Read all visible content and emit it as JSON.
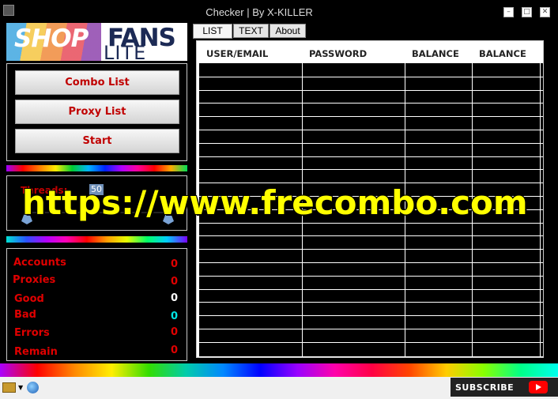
{
  "window": {
    "title": "Checker  | By X-KILLER"
  },
  "logo": {
    "line1": "SHOP",
    "line2": "FANS",
    "line3": "LITE"
  },
  "buttons": {
    "combo": "Combo List",
    "proxy": "Proxy List",
    "start": "Start"
  },
  "threads": {
    "label": "Threads:",
    "value": "50"
  },
  "stats": [
    {
      "label": "Accounts",
      "value": "0",
      "color": "#e00000"
    },
    {
      "label": "Proxies",
      "value": "0",
      "color": "#e00000"
    },
    {
      "label": "Good",
      "value": "0",
      "color": "#ffffff"
    },
    {
      "label": "Bad",
      "value": "0",
      "color": "#00e5e5"
    },
    {
      "label": "Errors",
      "value": "0",
      "color": "#e00000"
    },
    {
      "label": "Remain",
      "value": "0",
      "color": "#e00000"
    }
  ],
  "tabs": [
    "LIST",
    "TEXT",
    "About"
  ],
  "columns": [
    "USER/EMAIL",
    "PASSWORD",
    "BALANCE",
    "BALANCE"
  ],
  "watermark": "https://www.frecombo.com",
  "taskbar": {
    "subscribe": "SUBSCRIBE"
  }
}
